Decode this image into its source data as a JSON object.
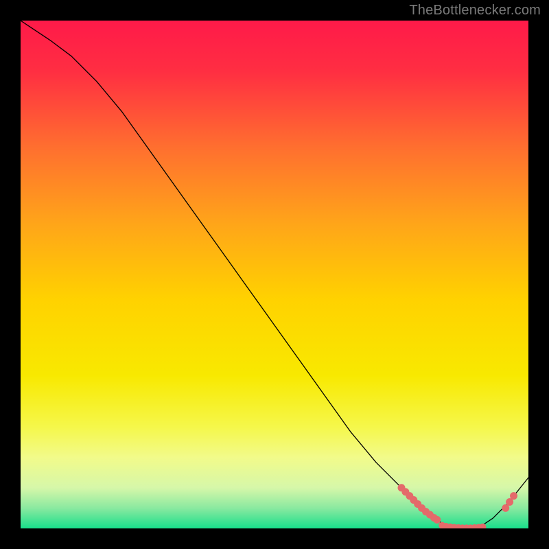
{
  "attribution": "TheBottlenecker.com",
  "chart_data": {
    "type": "line",
    "title": "",
    "xlabel": "",
    "ylabel": "",
    "xlim": [
      0,
      100
    ],
    "ylim": [
      0,
      100
    ],
    "background_gradient": {
      "stops": [
        {
          "offset": 0.0,
          "color": "#ff1a49"
        },
        {
          "offset": 0.1,
          "color": "#ff2e42"
        },
        {
          "offset": 0.25,
          "color": "#ff6f2f"
        },
        {
          "offset": 0.4,
          "color": "#ffa519"
        },
        {
          "offset": 0.55,
          "color": "#ffd200"
        },
        {
          "offset": 0.7,
          "color": "#f8e900"
        },
        {
          "offset": 0.8,
          "color": "#f5f74a"
        },
        {
          "offset": 0.86,
          "color": "#f2fb8a"
        },
        {
          "offset": 0.92,
          "color": "#d6f7a9"
        },
        {
          "offset": 0.96,
          "color": "#8ae9a0"
        },
        {
          "offset": 1.0,
          "color": "#18df8b"
        }
      ]
    },
    "series": [
      {
        "name": "bottleneck-curve",
        "color": "#000000",
        "stroke_width": 1.3,
        "x": [
          0,
          3,
          6,
          10,
          15,
          20,
          25,
          30,
          35,
          40,
          45,
          50,
          55,
          60,
          65,
          70,
          75,
          80,
          83,
          86,
          88,
          90,
          93,
          96,
          100
        ],
        "y": [
          100,
          98,
          96,
          93,
          88,
          82,
          75,
          68,
          61,
          54,
          47,
          40,
          33,
          26,
          19,
          13,
          8,
          3,
          1,
          0,
          0,
          0,
          2,
          5,
          10
        ]
      }
    ],
    "markers": [
      {
        "name": "cluster-left",
        "color": "#e46a6a",
        "radius": 5.5,
        "points": [
          {
            "x": 75.0,
            "y": 8.0
          },
          {
            "x": 75.8,
            "y": 7.2
          },
          {
            "x": 76.6,
            "y": 6.4
          },
          {
            "x": 77.4,
            "y": 5.6
          },
          {
            "x": 78.2,
            "y": 4.8
          },
          {
            "x": 79.0,
            "y": 4.0
          },
          {
            "x": 79.8,
            "y": 3.3
          },
          {
            "x": 80.6,
            "y": 2.7
          },
          {
            "x": 81.4,
            "y": 2.1
          },
          {
            "x": 82.0,
            "y": 1.7
          }
        ]
      },
      {
        "name": "cluster-bottom",
        "color": "#e46a6a",
        "radius": 5.0,
        "points": [
          {
            "x": 83.0,
            "y": 0.6
          },
          {
            "x": 83.8,
            "y": 0.4
          },
          {
            "x": 84.6,
            "y": 0.3
          },
          {
            "x": 85.4,
            "y": 0.2
          },
          {
            "x": 86.2,
            "y": 0.15
          },
          {
            "x": 87.0,
            "y": 0.1
          },
          {
            "x": 87.8,
            "y": 0.1
          },
          {
            "x": 88.6,
            "y": 0.1
          },
          {
            "x": 89.4,
            "y": 0.15
          },
          {
            "x": 90.2,
            "y": 0.2
          },
          {
            "x": 91.0,
            "y": 0.3
          }
        ]
      },
      {
        "name": "cluster-right",
        "color": "#e46a6a",
        "radius": 5.5,
        "points": [
          {
            "x": 95.5,
            "y": 4.0
          },
          {
            "x": 96.3,
            "y": 5.2
          },
          {
            "x": 97.1,
            "y": 6.4
          }
        ]
      }
    ]
  }
}
